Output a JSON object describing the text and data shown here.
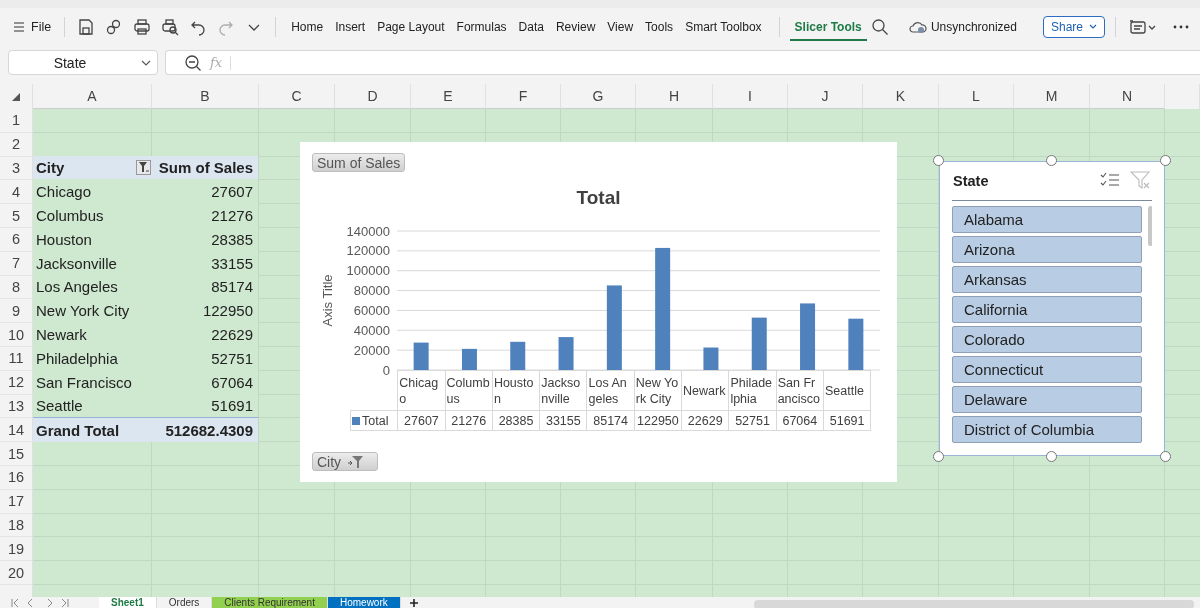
{
  "toolbar": {
    "file_label": "File",
    "quick_actions": [
      {
        "kind": "save",
        "disabled": false
      },
      {
        "kind": "link",
        "disabled": false
      },
      {
        "kind": "print",
        "disabled": false
      },
      {
        "kind": "preview",
        "disabled": false
      },
      {
        "kind": "undo",
        "disabled": false
      },
      {
        "kind": "redo",
        "disabled": true
      },
      {
        "kind": "more",
        "disabled": false
      }
    ],
    "tabs": [
      {
        "label": "Home",
        "selected": false
      },
      {
        "label": "Insert",
        "selected": false
      },
      {
        "label": "Page Layout",
        "selected": false
      },
      {
        "label": "Formulas",
        "selected": false
      },
      {
        "label": "Data",
        "selected": false
      },
      {
        "label": "Review",
        "selected": false
      },
      {
        "label": "View",
        "selected": false
      },
      {
        "label": "Tools",
        "selected": false
      },
      {
        "label": "Smart Toolbox",
        "selected": false
      }
    ],
    "context_tabs": [
      {
        "label": "Slicer Tools",
        "selected": true
      }
    ],
    "sync_status": "Unsynchronized",
    "share_label": "Share"
  },
  "formula_bar": {
    "name_box": "State",
    "function_label": "fx"
  },
  "sheet": {
    "columns": [
      "A",
      "B",
      "C",
      "D",
      "E",
      "F",
      "G",
      "H",
      "I",
      "J",
      "K",
      "L",
      "M",
      "N"
    ],
    "rows": [
      "1",
      "2",
      "3",
      "4",
      "5",
      "6",
      "7",
      "8",
      "9",
      "10",
      "11",
      "12",
      "13",
      "14",
      "15",
      "16",
      "17",
      "18",
      "19",
      "20"
    ]
  },
  "pivot_table": {
    "headers": [
      "City",
      "Sum of Sales"
    ],
    "filter_applied": true,
    "rows": [
      {
        "city": "Chicago",
        "sales": "27607"
      },
      {
        "city": "Columbus",
        "sales": "21276"
      },
      {
        "city": "Houston",
        "sales": "28385"
      },
      {
        "city": "Jacksonville",
        "sales": "33155"
      },
      {
        "city": "Los Angeles",
        "sales": "85174"
      },
      {
        "city": "New York City",
        "sales": "122950"
      },
      {
        "city": "Newark",
        "sales": "22629"
      },
      {
        "city": "Philadelphia",
        "sales": "52751"
      },
      {
        "city": "San Francisco",
        "sales": "67064"
      },
      {
        "city": "Seattle",
        "sales": "51691"
      }
    ],
    "total": {
      "label": "Grand Total",
      "value": "512682.4309"
    }
  },
  "chart": {
    "value_field": "Sum of Sales",
    "axis_field": "City",
    "axis_filter_applied": true,
    "chart_data": {
      "type": "bar",
      "title": "Total",
      "ylabel": "Axis Title",
      "categories": [
        "Chicago",
        "Columbus",
        "Houston",
        "Jacksonville",
        "Los Angeles",
        "New York City",
        "Newark",
        "Philadelphia",
        "San Francisco",
        "Seattle"
      ],
      "series": [
        {
          "name": "Total",
          "color": "#4f81bd",
          "values": [
            27607,
            21276,
            28385,
            33155,
            85174,
            122950,
            22629,
            52751,
            67064,
            51691
          ]
        }
      ],
      "ylim": [
        0,
        140000
      ],
      "yticks": [
        0,
        20000,
        40000,
        60000,
        80000,
        100000,
        120000,
        140000
      ],
      "grid": true
    },
    "data_table": {
      "values": [
        "27607",
        "21276",
        "28385",
        "33155",
        "85174",
        "122950",
        "22629",
        "52751",
        "67064",
        "51691"
      ]
    }
  },
  "slicer": {
    "title": "State",
    "items": [
      {
        "label": "Alabama",
        "selected": true
      },
      {
        "label": "Arizona",
        "selected": true
      },
      {
        "label": "Arkansas",
        "selected": true
      },
      {
        "label": "California",
        "selected": true
      },
      {
        "label": "Colorado",
        "selected": true
      },
      {
        "label": "Connecticut",
        "selected": true
      },
      {
        "label": "Delaware",
        "selected": true
      },
      {
        "label": "District of Columbia",
        "selected": true
      }
    ]
  },
  "sheet_tabs": [
    {
      "label": "Sheet1",
      "selected": true
    },
    {
      "label": "Orders",
      "selected": false
    },
    {
      "label": "Clients Requirement",
      "selected": false,
      "color": "#92d050"
    },
    {
      "label": "Homework",
      "selected": false,
      "color": "#0070c0"
    }
  ]
}
